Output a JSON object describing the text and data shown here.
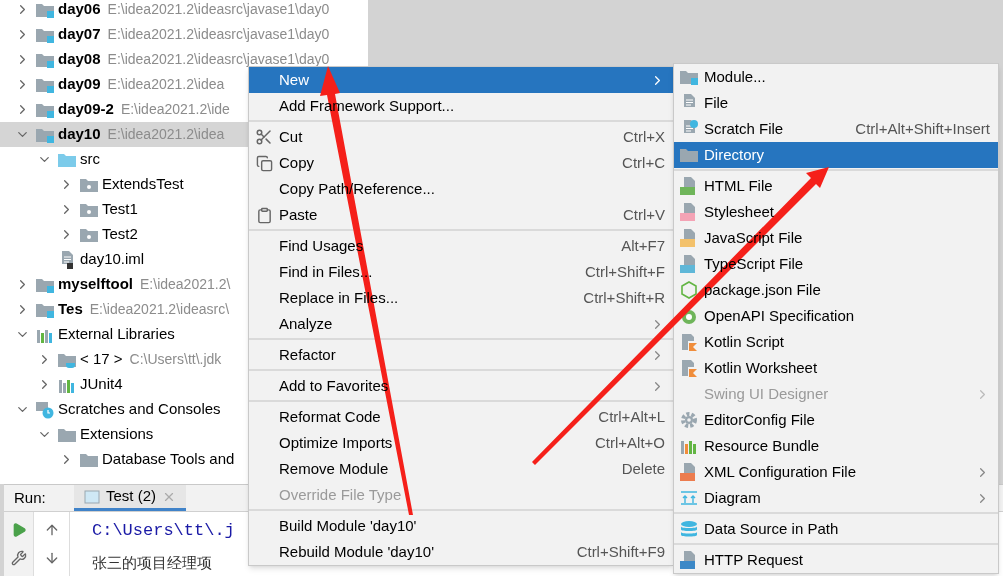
{
  "project_tree": {
    "items": [
      {
        "name": "day06",
        "path": "E:\\idea2021.2\\ideasrc\\javase1\\day0",
        "kind": "module",
        "expanded": false,
        "selected": false
      },
      {
        "name": "day07",
        "path": "E:\\idea2021.2\\ideasrc\\javase1\\day0",
        "kind": "module",
        "expanded": false,
        "selected": false
      },
      {
        "name": "day08",
        "path": "E:\\idea2021.2\\ideasrc\\javase1\\day0",
        "kind": "module",
        "expanded": false,
        "selected": false
      },
      {
        "name": "day09",
        "path": "E:\\idea2021.2\\idea",
        "kind": "module",
        "expanded": false,
        "selected": false
      },
      {
        "name": "day09-2",
        "path": "E:\\idea2021.2\\ide",
        "kind": "module",
        "expanded": false,
        "selected": false
      },
      {
        "name": "day10",
        "path": "E:\\idea2021.2\\idea",
        "kind": "module",
        "expanded": true,
        "selected": true,
        "children": [
          {
            "name": "src",
            "kind": "source-folder",
            "expanded": true,
            "selected": false,
            "children": [
              {
                "name": "ExtendsTest",
                "kind": "package",
                "expanded": false,
                "selected": false
              },
              {
                "name": "Test1",
                "kind": "package",
                "expanded": false,
                "selected": false
              },
              {
                "name": "Test2",
                "kind": "package",
                "expanded": false,
                "selected": false
              }
            ]
          },
          {
            "name": "day10.iml",
            "kind": "module-file",
            "selected": false
          }
        ]
      },
      {
        "name": "myselftool",
        "path": "E:\\idea2021.2\\",
        "kind": "module",
        "expanded": false,
        "selected": false
      },
      {
        "name": "Tes",
        "path": "E:\\idea2021.2\\ideasrc\\",
        "kind": "module",
        "expanded": false,
        "selected": false
      },
      {
        "name": "External Libraries",
        "kind": "libraries",
        "expanded": true,
        "selected": false,
        "children": [
          {
            "name": "< 17 >",
            "path": "C:\\Users\\tt\\.jdk",
            "kind": "sdk",
            "expanded": false,
            "selected": false
          },
          {
            "name": "JUnit4",
            "kind": "library",
            "expanded": false,
            "selected": false
          }
        ]
      },
      {
        "name": "Scratches and Consoles",
        "kind": "scratches",
        "expanded": true,
        "selected": false,
        "children": [
          {
            "name": "Extensions",
            "kind": "folder",
            "expanded": true,
            "selected": false,
            "children": [
              {
                "name": "Database Tools and",
                "kind": "folder",
                "expanded": false,
                "selected": false
              }
            ]
          }
        ]
      }
    ]
  },
  "run_panel": {
    "label": "Run:",
    "tabs": [
      {
        "label": "Test (2)",
        "selected": true
      }
    ],
    "console_lines": [
      {
        "text": "C:\\Users\\tt\\.j",
        "kind": "command"
      },
      {
        "text": "张三的项目经理项",
        "kind": "output"
      }
    ]
  },
  "context_menu": {
    "groups": [
      [
        {
          "label": "New",
          "submenu": true,
          "selected": true,
          "disabled": false
        },
        {
          "label": "Add Framework Support...",
          "submenu": false,
          "selected": false,
          "disabled": false
        }
      ],
      [
        {
          "label": "Cut",
          "shortcut": "Ctrl+X",
          "submenu": false,
          "selected": false,
          "disabled": false
        },
        {
          "label": "Copy",
          "shortcut": "Ctrl+C",
          "submenu": false,
          "selected": false,
          "disabled": false
        },
        {
          "label": "Copy Path/Reference...",
          "submenu": false,
          "selected": false,
          "disabled": false
        },
        {
          "label": "Paste",
          "shortcut": "Ctrl+V",
          "submenu": false,
          "selected": false,
          "disabled": false
        }
      ],
      [
        {
          "label": "Find Usages",
          "shortcut": "Alt+F7",
          "submenu": false,
          "selected": false,
          "disabled": false
        },
        {
          "label": "Find in Files...",
          "shortcut": "Ctrl+Shift+F",
          "submenu": false,
          "selected": false,
          "disabled": false
        },
        {
          "label": "Replace in Files...",
          "shortcut": "Ctrl+Shift+R",
          "submenu": false,
          "selected": false,
          "disabled": false
        },
        {
          "label": "Analyze",
          "submenu": true,
          "selected": false,
          "disabled": false
        }
      ],
      [
        {
          "label": "Refactor",
          "submenu": true,
          "selected": false,
          "disabled": false
        }
      ],
      [
        {
          "label": "Add to Favorites",
          "submenu": true,
          "selected": false,
          "disabled": false
        }
      ],
      [
        {
          "label": "Reformat Code",
          "shortcut": "Ctrl+Alt+L",
          "submenu": false,
          "selected": false,
          "disabled": false
        },
        {
          "label": "Optimize Imports",
          "shortcut": "Ctrl+Alt+O",
          "submenu": false,
          "selected": false,
          "disabled": false
        },
        {
          "label": "Remove Module",
          "shortcut": "Delete",
          "submenu": false,
          "selected": false,
          "disabled": false
        },
        {
          "label": "Override File Type",
          "submenu": false,
          "selected": false,
          "disabled": true
        }
      ],
      [
        {
          "label": "Build Module 'day10'",
          "submenu": false,
          "selected": false,
          "disabled": false
        },
        {
          "label": "Rebuild Module 'day10'",
          "shortcut": "Ctrl+Shift+F9",
          "submenu": false,
          "selected": false,
          "disabled": false
        }
      ]
    ]
  },
  "new_submenu": {
    "groups": [
      [
        {
          "label": "Module...",
          "submenu": false,
          "selected": false,
          "disabled": false
        },
        {
          "label": "File",
          "submenu": false,
          "selected": false,
          "disabled": false
        },
        {
          "label": "Scratch File",
          "shortcut": "Ctrl+Alt+Shift+Insert",
          "submenu": false,
          "selected": false,
          "disabled": false
        },
        {
          "label": "Directory",
          "submenu": false,
          "selected": true,
          "disabled": false
        }
      ],
      [
        {
          "label": "HTML File",
          "submenu": false,
          "selected": false,
          "disabled": false
        },
        {
          "label": "Stylesheet",
          "submenu": false,
          "selected": false,
          "disabled": false
        },
        {
          "label": "JavaScript File",
          "submenu": false,
          "selected": false,
          "disabled": false
        },
        {
          "label": "TypeScript File",
          "submenu": false,
          "selected": false,
          "disabled": false
        },
        {
          "label": "package.json File",
          "submenu": false,
          "selected": false,
          "disabled": false
        },
        {
          "label": "OpenAPI Specification",
          "submenu": false,
          "selected": false,
          "disabled": false
        },
        {
          "label": "Kotlin Script",
          "submenu": false,
          "selected": false,
          "disabled": false
        },
        {
          "label": "Kotlin Worksheet",
          "submenu": false,
          "selected": false,
          "disabled": false
        },
        {
          "label": "Swing UI Designer",
          "submenu": true,
          "selected": false,
          "disabled": true
        },
        {
          "label": "EditorConfig File",
          "submenu": false,
          "selected": false,
          "disabled": false
        },
        {
          "label": "Resource Bundle",
          "submenu": false,
          "selected": false,
          "disabled": false
        },
        {
          "label": "XML Configuration File",
          "submenu": true,
          "selected": false,
          "disabled": false
        },
        {
          "label": "Diagram",
          "submenu": true,
          "selected": false,
          "disabled": false
        }
      ],
      [
        {
          "label": "Data Source in Path",
          "submenu": false,
          "selected": false,
          "disabled": false
        }
      ],
      [
        {
          "label": "HTTP Request",
          "submenu": false,
          "selected": false,
          "disabled": false
        }
      ]
    ]
  }
}
